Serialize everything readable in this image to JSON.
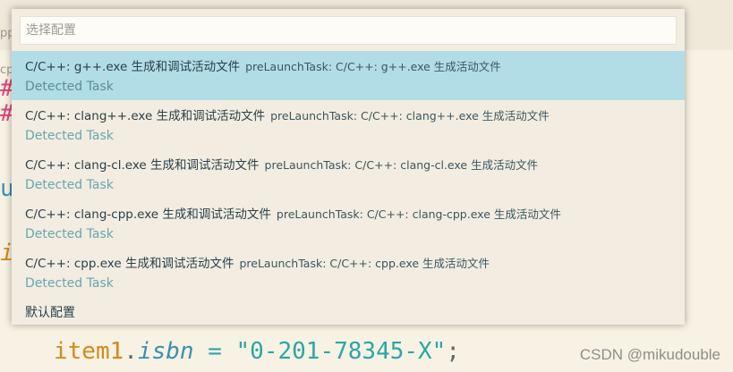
{
  "editor": {
    "tab_fragment": "pp",
    "tab_fragment2": "cp",
    "glyph1": "#",
    "glyph2": "#",
    "glyph3": "u",
    "glyph4": "i",
    "code": {
      "var": "item1",
      "dot": ".",
      "prop": "isbn",
      "op": " = ",
      "str": "\"0-201-78345-X\"",
      "punc": ";"
    }
  },
  "quickpick": {
    "placeholder": "选择配置",
    "items": [
      {
        "label": "C/C++: g++.exe 生成和调试活动文件",
        "description": "preLaunchTask: C/C++: g++.exe 生成活动文件",
        "detail": "Detected Task",
        "selected": true
      },
      {
        "label": "C/C++: clang++.exe 生成和调试活动文件",
        "description": "preLaunchTask: C/C++: clang++.exe 生成活动文件",
        "detail": "Detected Task",
        "selected": false
      },
      {
        "label": "C/C++: clang-cl.exe 生成和调试活动文件",
        "description": "preLaunchTask: C/C++: clang-cl.exe 生成活动文件",
        "detail": "Detected Task",
        "selected": false
      },
      {
        "label": "C/C++: clang-cpp.exe 生成和调试活动文件",
        "description": "preLaunchTask: C/C++: clang-cpp.exe 生成活动文件",
        "detail": "Detected Task",
        "selected": false
      },
      {
        "label": "C/C++: cpp.exe 生成和调试活动文件",
        "description": "preLaunchTask: C/C++: cpp.exe 生成活动文件",
        "detail": "Detected Task",
        "selected": false
      }
    ],
    "default_label": "默认配置"
  },
  "watermark": "CSDN @mikudouble",
  "colors": {
    "selected_row": "#b2dde6",
    "panel": "#f2ede0",
    "editor_bg": "#f7f2e3"
  }
}
